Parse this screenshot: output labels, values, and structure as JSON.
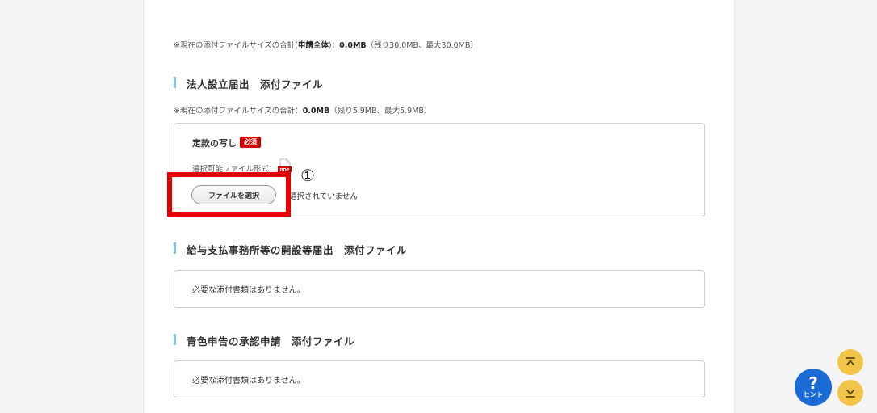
{
  "total_note": {
    "prefix": "※現在の添付ファイルサイズの合計(",
    "scope": "申請全体",
    "mid": ")：",
    "size": "0.0MB",
    "remaining": "（残り30.0MB、最大30.0MB）"
  },
  "section1": {
    "heading": "法人設立届出　添付ファイル",
    "note_prefix": "※現在の添付ファイルサイズの合計：",
    "note_size": "0.0MB",
    "note_remaining": "（残り5.9MB、最大5.9MB）",
    "doc_title": "定款の写し",
    "required_badge": "必須",
    "formats_label": "選択可能ファイル形式：",
    "pdf_label": "PDF",
    "file_button": "ファイルを選択",
    "no_file_text": "選択されていません"
  },
  "section2": {
    "heading": "給与支払事務所等の開設等届出　添付ファイル",
    "empty_text": "必要な添付書類はありません。"
  },
  "section3": {
    "heading": "青色申告の承認申請　添付ファイル",
    "empty_text": "必要な添付書類はありません。"
  },
  "annotation": {
    "marker": "①"
  },
  "floating": {
    "hint_symbol": "?",
    "hint_label": "ヒント"
  },
  "colors": {
    "accent_bar": "#7ec4e8",
    "required_red": "#d40000",
    "highlight_red": "#e60000",
    "hint_blue": "#1a6bd6",
    "scroll_yellow": "#f2c447"
  }
}
